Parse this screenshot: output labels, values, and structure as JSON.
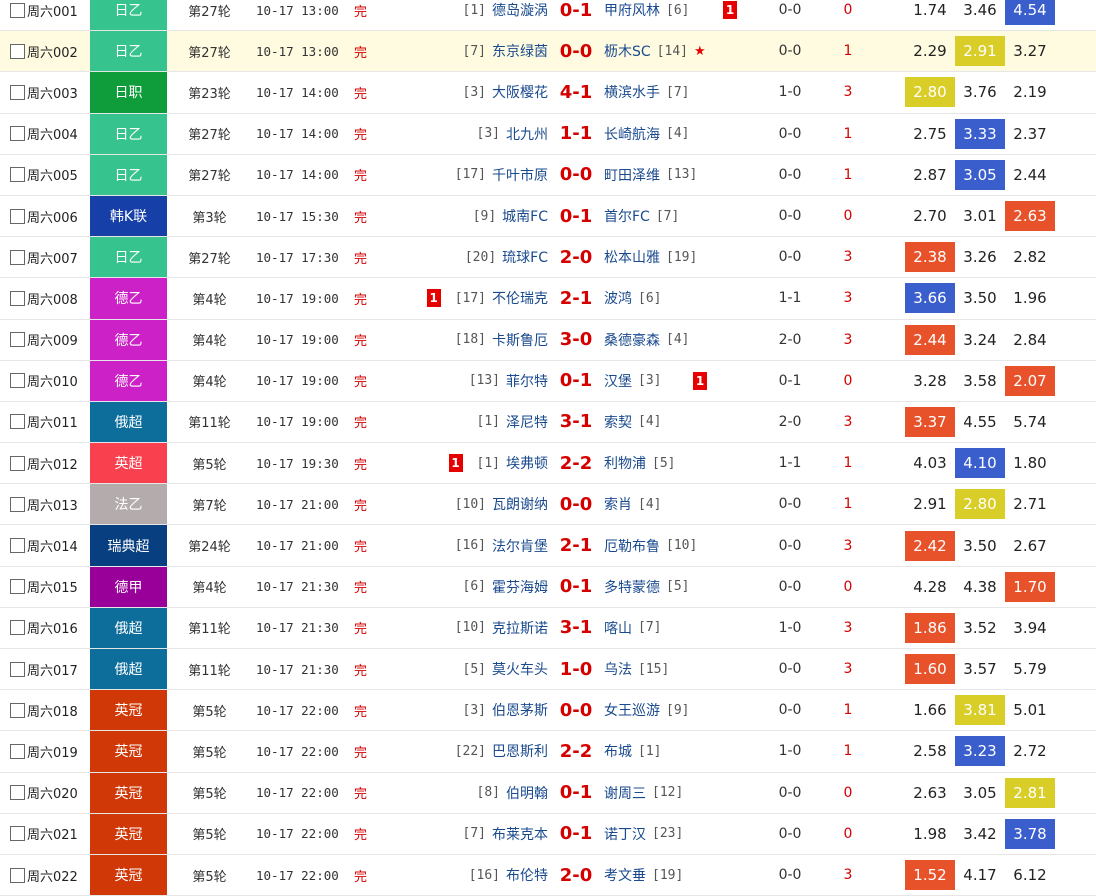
{
  "matches": [
    {
      "id": "周六001",
      "league": "日乙",
      "league_color": "#36c38d",
      "round": "第27轮",
      "time": "10-17 13:00",
      "status": "完",
      "home_rank": "[1]",
      "home": "德岛漩涡",
      "score": "0-1",
      "away": "甲府风林",
      "away_rank": "[6]",
      "home_red": "",
      "away_red": "1",
      "star": "",
      "half": "0-0",
      "result": "0",
      "odds": [
        "1.74",
        "3.46",
        "4.54"
      ],
      "hl": [
        null,
        null,
        "blue"
      ],
      "highlight": false
    },
    {
      "id": "周六002",
      "league": "日乙",
      "league_color": "#36c38d",
      "round": "第27轮",
      "time": "10-17 13:00",
      "status": "完",
      "home_rank": "[7]",
      "home": "东京绿茵",
      "score": "0-0",
      "away": "枥木SC",
      "away_rank": "[14]",
      "home_red": "",
      "away_red": "",
      "star": "★",
      "half": "0-0",
      "result": "1",
      "odds": [
        "2.29",
        "2.91",
        "3.27"
      ],
      "hl": [
        null,
        "yellow",
        null
      ],
      "highlight": true
    },
    {
      "id": "周六003",
      "league": "日职",
      "league_color": "#0e9d3a",
      "round": "第23轮",
      "time": "10-17 14:00",
      "status": "完",
      "home_rank": "[3]",
      "home": "大阪樱花",
      "score": "4-1",
      "away": "横滨水手",
      "away_rank": "[7]",
      "home_red": "",
      "away_red": "",
      "star": "",
      "half": "1-0",
      "result": "3",
      "odds": [
        "2.80",
        "3.76",
        "2.19"
      ],
      "hl": [
        "yellow",
        null,
        null
      ],
      "highlight": false
    },
    {
      "id": "周六004",
      "league": "日乙",
      "league_color": "#36c38d",
      "round": "第27轮",
      "time": "10-17 14:00",
      "status": "完",
      "home_rank": "[3]",
      "home": "北九州",
      "score": "1-1",
      "away": "长崎航海",
      "away_rank": "[4]",
      "home_red": "",
      "away_red": "",
      "star": "",
      "half": "0-0",
      "result": "1",
      "odds": [
        "2.75",
        "3.33",
        "2.37"
      ],
      "hl": [
        null,
        "blue",
        null
      ],
      "highlight": false
    },
    {
      "id": "周六005",
      "league": "日乙",
      "league_color": "#36c38d",
      "round": "第27轮",
      "time": "10-17 14:00",
      "status": "完",
      "home_rank": "[17]",
      "home": "千叶市原",
      "score": "0-0",
      "away": "町田泽维",
      "away_rank": "[13]",
      "home_red": "",
      "away_red": "",
      "star": "",
      "half": "0-0",
      "result": "1",
      "odds": [
        "2.87",
        "3.05",
        "2.44"
      ],
      "hl": [
        null,
        "blue",
        null
      ],
      "highlight": false
    },
    {
      "id": "周六006",
      "league": "韩K联",
      "league_color": "#1640a8",
      "round": "第3轮",
      "time": "10-17 15:30",
      "status": "完",
      "home_rank": "[9]",
      "home": "城南FC",
      "score": "0-1",
      "away": "首尔FC",
      "away_rank": "[7]",
      "home_red": "",
      "away_red": "",
      "star": "",
      "half": "0-0",
      "result": "0",
      "odds": [
        "2.70",
        "3.01",
        "2.63"
      ],
      "hl": [
        null,
        null,
        "red"
      ],
      "highlight": false
    },
    {
      "id": "周六007",
      "league": "日乙",
      "league_color": "#36c38d",
      "round": "第27轮",
      "time": "10-17 17:30",
      "status": "完",
      "home_rank": "[20]",
      "home": "琉球FC",
      "score": "2-0",
      "away": "松本山雅",
      "away_rank": "[19]",
      "home_red": "",
      "away_red": "",
      "star": "",
      "half": "0-0",
      "result": "3",
      "odds": [
        "2.38",
        "3.26",
        "2.82"
      ],
      "hl": [
        "red",
        null,
        null
      ],
      "highlight": false
    },
    {
      "id": "周六008",
      "league": "德乙",
      "league_color": "#cc21c7",
      "round": "第4轮",
      "time": "10-17 19:00",
      "status": "完",
      "home_rank": "[17]",
      "home": "不伦瑞克",
      "score": "2-1",
      "away": "波鸿",
      "away_rank": "[6]",
      "home_red": "1",
      "away_red": "",
      "star": "",
      "half": "1-1",
      "result": "3",
      "odds": [
        "3.66",
        "3.50",
        "1.96"
      ],
      "hl": [
        "blue",
        null,
        null
      ],
      "highlight": false
    },
    {
      "id": "周六009",
      "league": "德乙",
      "league_color": "#cc21c7",
      "round": "第4轮",
      "time": "10-17 19:00",
      "status": "完",
      "home_rank": "[18]",
      "home": "卡斯鲁厄",
      "score": "3-0",
      "away": "桑德豪森",
      "away_rank": "[4]",
      "home_red": "",
      "away_red": "",
      "star": "",
      "half": "2-0",
      "result": "3",
      "odds": [
        "2.44",
        "3.24",
        "2.84"
      ],
      "hl": [
        "red",
        null,
        null
      ],
      "highlight": false
    },
    {
      "id": "周六010",
      "league": "德乙",
      "league_color": "#cc21c7",
      "round": "第4轮",
      "time": "10-17 19:00",
      "status": "完",
      "home_rank": "[13]",
      "home": "菲尔特",
      "score": "0-1",
      "away": "汉堡",
      "away_rank": "[3]",
      "home_red": "",
      "away_red": "1",
      "star": "",
      "half": "0-1",
      "result": "0",
      "odds": [
        "3.28",
        "3.58",
        "2.07"
      ],
      "hl": [
        null,
        null,
        "red"
      ],
      "highlight": false
    },
    {
      "id": "周六011",
      "league": "俄超",
      "league_color": "#0d6e9c",
      "round": "第11轮",
      "time": "10-17 19:00",
      "status": "完",
      "home_rank": "[1]",
      "home": "泽尼特",
      "score": "3-1",
      "away": "索契",
      "away_rank": "[4]",
      "home_red": "",
      "away_red": "",
      "star": "",
      "half": "2-0",
      "result": "3",
      "odds": [
        "3.37",
        "4.55",
        "5.74"
      ],
      "hl": [
        "red",
        null,
        null
      ],
      "highlight": false
    },
    {
      "id": "周六012",
      "league": "英超",
      "league_color": "#f8404f",
      "round": "第5轮",
      "time": "10-17 19:30",
      "status": "完",
      "home_rank": "[1]",
      "home": "埃弗顿",
      "score": "2-2",
      "away": "利物浦",
      "away_rank": "[5]",
      "home_red": "1",
      "away_red": "",
      "star": "",
      "half": "1-1",
      "result": "1",
      "odds": [
        "4.03",
        "4.10",
        "1.80"
      ],
      "hl": [
        null,
        "blue",
        null
      ],
      "highlight": false
    },
    {
      "id": "周六013",
      "league": "法乙",
      "league_color": "#b4acac",
      "round": "第7轮",
      "time": "10-17 21:00",
      "status": "完",
      "home_rank": "[10]",
      "home": "瓦朗谢纳",
      "score": "0-0",
      "away": "索肖",
      "away_rank": "[4]",
      "home_red": "",
      "away_red": "",
      "star": "",
      "half": "0-0",
      "result": "1",
      "odds": [
        "2.91",
        "2.80",
        "2.71"
      ],
      "hl": [
        null,
        "yellow",
        null
      ],
      "highlight": false
    },
    {
      "id": "周六014",
      "league": "瑞典超",
      "league_color": "#073f80",
      "round": "第24轮",
      "time": "10-17 21:00",
      "status": "完",
      "home_rank": "[16]",
      "home": "法尔肯堡",
      "score": "2-1",
      "away": "厄勒布鲁",
      "away_rank": "[10]",
      "home_red": "",
      "away_red": "",
      "star": "",
      "half": "0-0",
      "result": "3",
      "odds": [
        "2.42",
        "3.50",
        "2.67"
      ],
      "hl": [
        "red",
        null,
        null
      ],
      "highlight": false
    },
    {
      "id": "周六015",
      "league": "德甲",
      "league_color": "#990099",
      "round": "第4轮",
      "time": "10-17 21:30",
      "status": "完",
      "home_rank": "[6]",
      "home": "霍芬海姆",
      "score": "0-1",
      "away": "多特蒙德",
      "away_rank": "[5]",
      "home_red": "",
      "away_red": "",
      "star": "",
      "half": "0-0",
      "result": "0",
      "odds": [
        "4.28",
        "4.38",
        "1.70"
      ],
      "hl": [
        null,
        null,
        "red"
      ],
      "highlight": false
    },
    {
      "id": "周六016",
      "league": "俄超",
      "league_color": "#0d6e9c",
      "round": "第11轮",
      "time": "10-17 21:30",
      "status": "完",
      "home_rank": "[10]",
      "home": "克拉斯诺",
      "score": "3-1",
      "away": "喀山",
      "away_rank": "[7]",
      "home_red": "",
      "away_red": "",
      "star": "",
      "half": "1-0",
      "result": "3",
      "odds": [
        "1.86",
        "3.52",
        "3.94"
      ],
      "hl": [
        "red",
        null,
        null
      ],
      "highlight": false
    },
    {
      "id": "周六017",
      "league": "俄超",
      "league_color": "#0d6e9c",
      "round": "第11轮",
      "time": "10-17 21:30",
      "status": "完",
      "home_rank": "[5]",
      "home": "莫火车头",
      "score": "1-0",
      "away": "乌法",
      "away_rank": "[15]",
      "home_red": "",
      "away_red": "",
      "star": "",
      "half": "0-0",
      "result": "3",
      "odds": [
        "1.60",
        "3.57",
        "5.79"
      ],
      "hl": [
        "red",
        null,
        null
      ],
      "highlight": false
    },
    {
      "id": "周六018",
      "league": "英冠",
      "league_color": "#d03808",
      "round": "第5轮",
      "time": "10-17 22:00",
      "status": "完",
      "home_rank": "[3]",
      "home": "伯恩茅斯",
      "score": "0-0",
      "away": "女王巡游",
      "away_rank": "[9]",
      "home_red": "",
      "away_red": "",
      "star": "",
      "half": "0-0",
      "result": "1",
      "odds": [
        "1.66",
        "3.81",
        "5.01"
      ],
      "hl": [
        null,
        "yellow",
        null
      ],
      "highlight": false
    },
    {
      "id": "周六019",
      "league": "英冠",
      "league_color": "#d03808",
      "round": "第5轮",
      "time": "10-17 22:00",
      "status": "完",
      "home_rank": "[22]",
      "home": "巴恩斯利",
      "score": "2-2",
      "away": "布城",
      "away_rank": "[1]",
      "home_red": "",
      "away_red": "",
      "star": "",
      "half": "1-0",
      "result": "1",
      "odds": [
        "2.58",
        "3.23",
        "2.72"
      ],
      "hl": [
        null,
        "blue",
        null
      ],
      "highlight": false
    },
    {
      "id": "周六020",
      "league": "英冠",
      "league_color": "#d03808",
      "round": "第5轮",
      "time": "10-17 22:00",
      "status": "完",
      "home_rank": "[8]",
      "home": "伯明翰",
      "score": "0-1",
      "away": "谢周三",
      "away_rank": "[12]",
      "home_red": "",
      "away_red": "",
      "star": "",
      "half": "0-0",
      "result": "0",
      "odds": [
        "2.63",
        "3.05",
        "2.81"
      ],
      "hl": [
        null,
        null,
        "yellow"
      ],
      "highlight": false
    },
    {
      "id": "周六021",
      "league": "英冠",
      "league_color": "#d03808",
      "round": "第5轮",
      "time": "10-17 22:00",
      "status": "完",
      "home_rank": "[7]",
      "home": "布莱克本",
      "score": "0-1",
      "away": "诺丁汉",
      "away_rank": "[23]",
      "home_red": "",
      "away_red": "",
      "star": "",
      "half": "0-0",
      "result": "0",
      "odds": [
        "1.98",
        "3.42",
        "3.78"
      ],
      "hl": [
        null,
        null,
        "blue"
      ],
      "highlight": false
    },
    {
      "id": "周六022",
      "league": "英冠",
      "league_color": "#d03808",
      "round": "第5轮",
      "time": "10-17 22:00",
      "status": "完",
      "home_rank": "[16]",
      "home": "布伦特",
      "score": "2-0",
      "away": "考文垂",
      "away_rank": "[19]",
      "home_red": "",
      "away_red": "",
      "star": "",
      "half": "0-0",
      "result": "3",
      "odds": [
        "1.52",
        "4.17",
        "6.12"
      ],
      "hl": [
        "red",
        null,
        null
      ],
      "highlight": false
    }
  ]
}
